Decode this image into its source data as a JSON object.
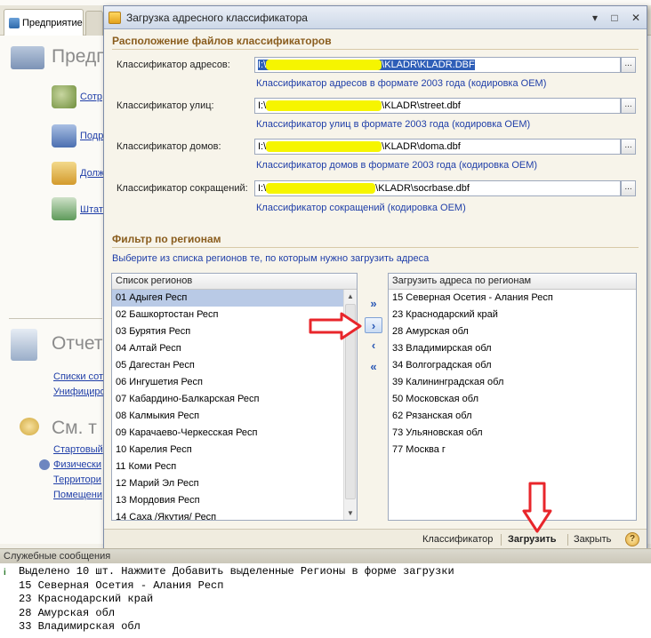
{
  "background": {
    "tabs": [
      {
        "label": "Предприятие"
      }
    ],
    "sections": [
      {
        "title": "Предп",
        "links": [
          "Сотр",
          "Подр",
          "Долж",
          "Штат"
        ]
      },
      {
        "title": "Отчет",
        "links": [
          "Списки сот",
          "Унифициро"
        ]
      },
      {
        "title": "См. т",
        "links": [
          "Стартовый",
          "Физически",
          "Территори",
          "Помещени"
        ]
      }
    ]
  },
  "dialog": {
    "title": "Загрузка адресного классификатора",
    "files_group_title": "Расположение файлов классификаторов",
    "files": [
      {
        "label": "Классификатор адресов:",
        "prefix": "I:\\",
        "suffix": "\\KLADR\\KLADR.DBF",
        "hint": "Классификатор адресов в формате  2003 года  (кодировка OEM)"
      },
      {
        "label": "Классификатор улиц:",
        "prefix": "I:\\",
        "suffix": "\\KLADR\\street.dbf",
        "hint": "Классификатор улиц в формате  2003 года  (кодировка OEM)"
      },
      {
        "label": "Классификатор домов:",
        "prefix": "I:\\",
        "suffix": "\\KLADR\\doma.dbf",
        "hint": "Классификатор домов в формате  2003 года  (кодировка OEM)"
      },
      {
        "label": "Классификатор сокращений:",
        "prefix": "I:\\",
        "suffix": "\\KLADR\\socrbase.dbf",
        "hint": "Классификатор сокращений (кодировка OEM)"
      }
    ],
    "browse_label": "...",
    "filter_group_title": "Фильтр по регионам",
    "filter_description": "Выберите из списка регионов те, по которым нужно загрузить адреса",
    "regions_header": "Список регионов",
    "regions": [
      "01 Адыгея Респ",
      "02 Башкортостан Респ",
      "03 Бурятия Респ",
      "04 Алтай Респ",
      "05 Дагестан Респ",
      "06 Ингушетия Респ",
      "07 Кабардино-Балкарская Респ",
      "08 Калмыкия Респ",
      "09 Карачаево-Черкесская Респ",
      "10 Карелия Респ",
      "11 Коми Респ",
      "12 Марий Эл Респ",
      "13 Мордовия Респ",
      "14 Саха /Якутия/ Респ"
    ],
    "selected_region_index": 0,
    "load_header": "Загрузить адреса по регионам",
    "load_regions": [
      "15 Северная Осетия - Алания Респ",
      "23 Краснодарский край",
      "28 Амурская обл",
      "33 Владимирская обл",
      "34 Волгоградская обл",
      "39 Калининградская обл",
      "50 Московская обл",
      "62 Рязанская обл",
      "73 Ульяновская обл",
      "77 Москва г"
    ],
    "move_buttons": {
      "add_all": "»",
      "add": "›",
      "remove": "‹",
      "remove_all": "«"
    },
    "footer": {
      "classifier": "Классификатор",
      "load": "Загрузить",
      "close": "Закрыть",
      "help": "?"
    }
  },
  "messages": {
    "title": "Служебные сообщения",
    "icon": "i",
    "lines": [
      "Выделено 10 шт. Нажмите Добавить выделенные Регионы в форме загрузки",
      "15 Северная Осетия - Алания Респ",
      "23 Краснодарский край",
      "28 Амурская обл",
      "33 Владимирская обл"
    ]
  },
  "colors": {
    "annotation_arrow": "#e8262b",
    "highlight": "#f6f500",
    "link": "#1f3ea8",
    "selection": "#b9cae6"
  }
}
